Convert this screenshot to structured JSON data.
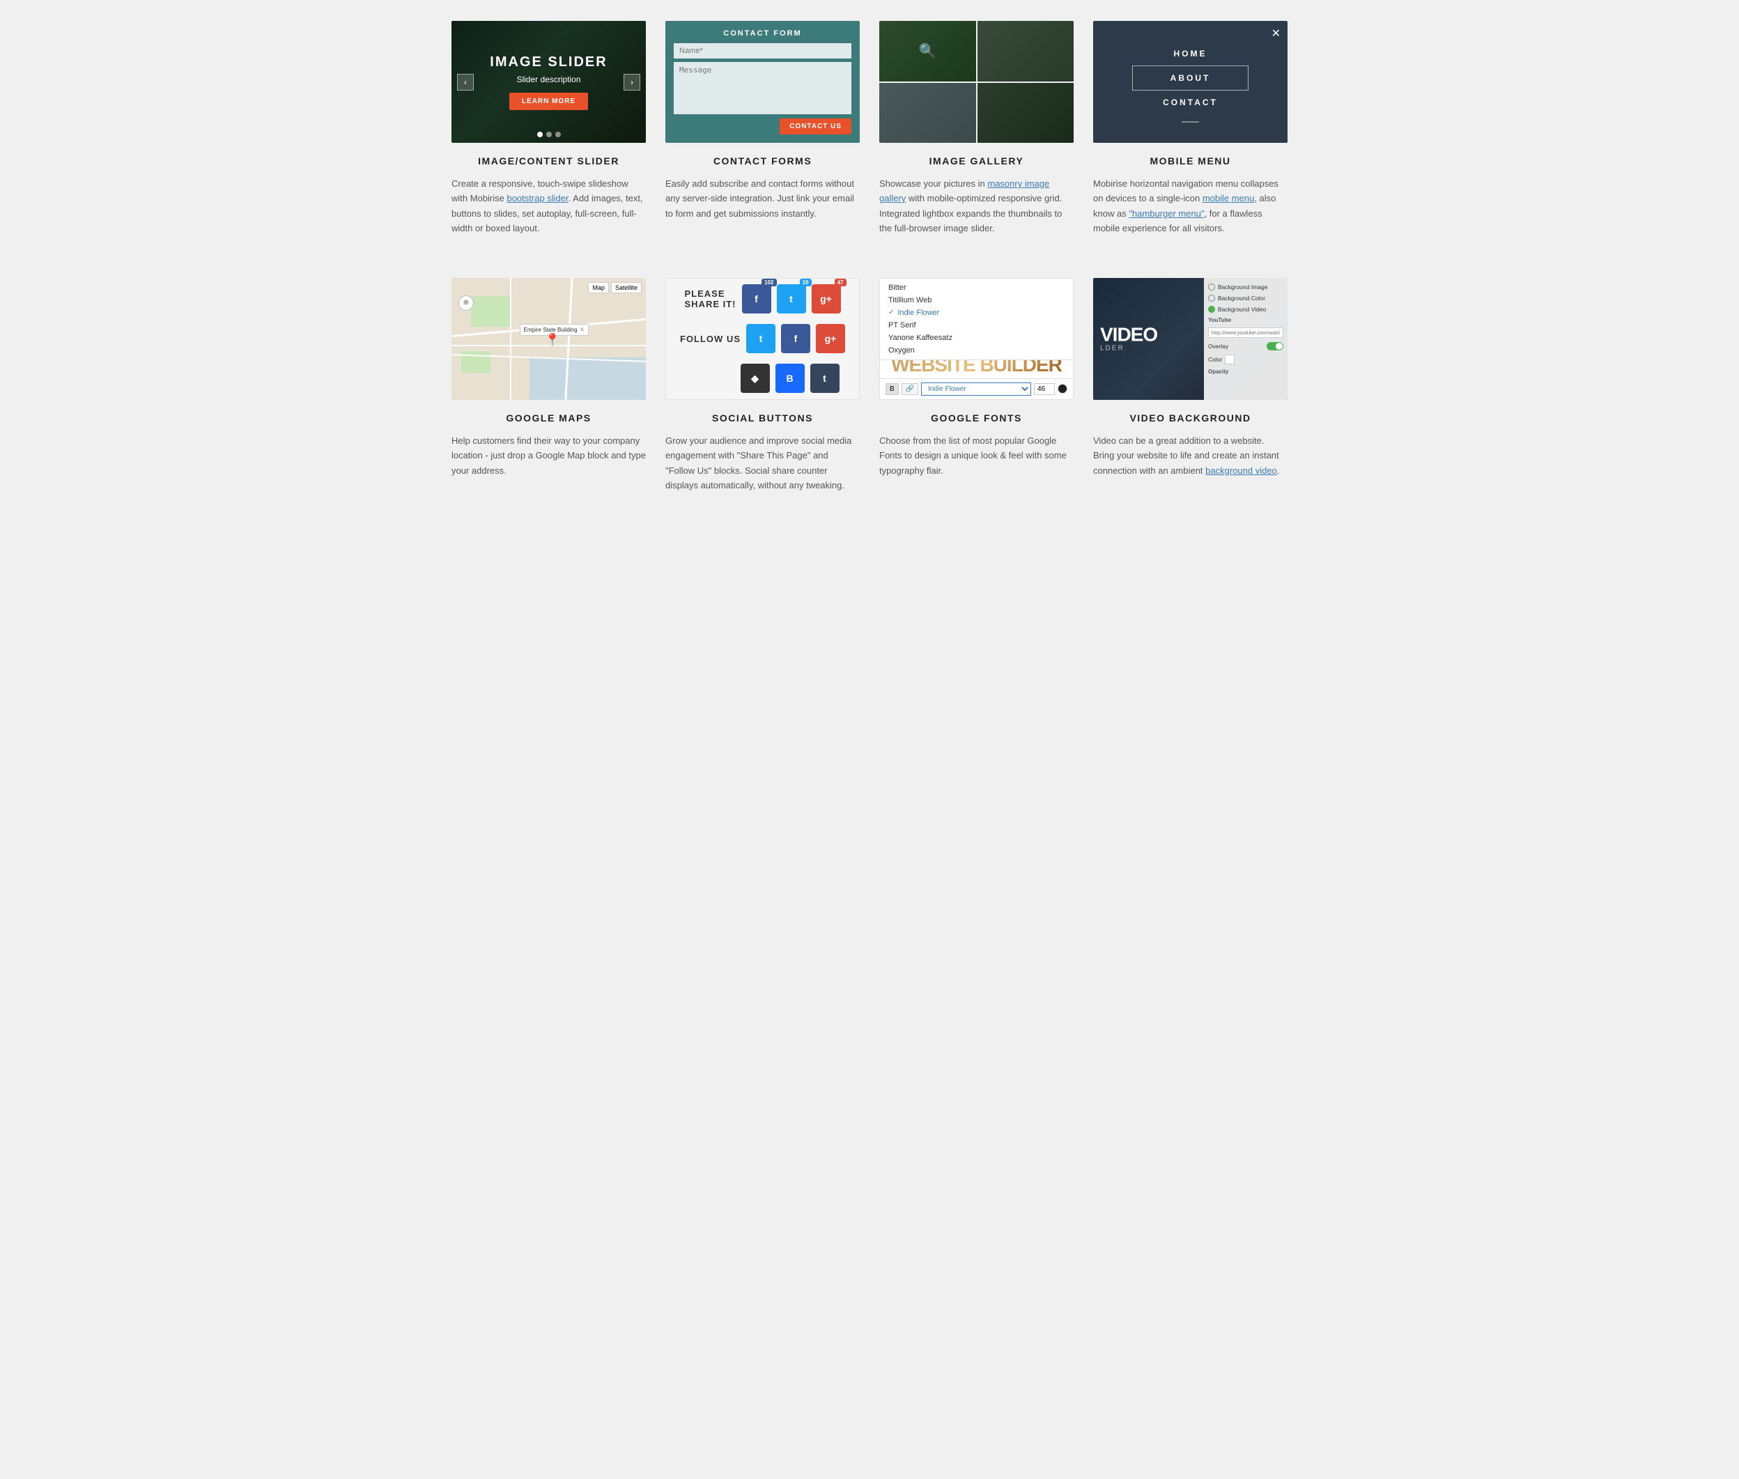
{
  "page": {
    "background": "#f0f0f0"
  },
  "row1": {
    "cards": [
      {
        "id": "image-slider",
        "title": "IMAGE/CONTENT SLIDER",
        "preview_title": "IMAGE SLIDER",
        "preview_desc": "Slider description",
        "btn_label": "LEARN MORE",
        "desc": "Create a responsive, touch-swipe slideshow with Mobirise ",
        "link1_text": "bootstrap slider",
        "link1_href": "#",
        "desc2": ". Add images, text, buttons to slides, set autoplay, full-screen, full-width or boxed layout.",
        "dots": 3,
        "arrows": [
          "‹",
          "›"
        ]
      },
      {
        "id": "contact-forms",
        "title": "CONTACT FORMS",
        "form_title": "CONTACT FORM",
        "name_placeholder": "Name*",
        "message_placeholder": "Message",
        "submit_label": "CONTACT US",
        "desc": "Easily add subscribe and contact forms without any server-side integration. Just link your email to form and get submissions instantly."
      },
      {
        "id": "image-gallery",
        "title": "IMAGE GALLERY",
        "desc": "Showcase your pictures in ",
        "link1_text": "masonry image gallery",
        "link1_href": "#",
        "desc2": " with mobile-optimized responsive grid. Integrated lightbox expands the thumbnails to the full-browser image slider."
      },
      {
        "id": "mobile-menu",
        "title": "MOBILE MENU",
        "menu_items": [
          "HOME",
          "ABOUT",
          "CONTACT"
        ],
        "active_item": "ABOUT",
        "desc": "Mobirise horizontal navigation menu collapses on devices to a single-icon ",
        "link1_text": "mobile menu",
        "link1_href": "#",
        "desc2": ", also know as ",
        "link2_text": "\"hamburger menu\"",
        "link2_href": "#",
        "desc3": ", for a flawless mobile experience for all visitors."
      }
    ]
  },
  "row2": {
    "cards": [
      {
        "id": "google-maps",
        "title": "GOOGLE MAPS",
        "map_label": "Empire State Building",
        "desc": "Help customers find their way to your company location - just drop a Google Map block and type your address."
      },
      {
        "id": "social-buttons",
        "title": "SOCIAL BUTTONS",
        "share_label": "PLEASE\nSHARE IT!",
        "follow_label": "FOLLOW US",
        "share_buttons": [
          {
            "type": "fb",
            "label": "f",
            "count": "102"
          },
          {
            "type": "tw",
            "label": "t",
            "count": "19"
          },
          {
            "type": "gp",
            "label": "g+",
            "count": "47"
          }
        ],
        "follow_buttons": [
          {
            "type": "tw",
            "label": "t"
          },
          {
            "type": "fb",
            "label": "f"
          },
          {
            "type": "gp",
            "label": "g+"
          }
        ],
        "extra_buttons": [
          {
            "type": "gh",
            "label": "◆"
          },
          {
            "type": "be",
            "label": "B"
          },
          {
            "type": "tm",
            "label": "t"
          }
        ],
        "desc": "Grow your audience and improve social media engagement with \"Share This Page\" and \"Follow Us\" blocks. Social share counter displays automatically, without any tweaking."
      },
      {
        "id": "google-fonts",
        "title": "GOOGLE FONTS",
        "font_list": [
          "Bitter",
          "Titillium Web",
          "Indie Flower",
          "PT Serif",
          "Yanone Kaffeesatz",
          "Oxygen"
        ],
        "selected_font": "Indie Flower",
        "font_size": "46",
        "preview_text": "WEBSITE BUILDER",
        "desc": "Choose from the list of most popular Google Fonts to design a unique look & feel with some typography flair."
      },
      {
        "id": "video-background",
        "title": "VIDEO BACKGROUND",
        "video_title": "VIDEO",
        "video_subtitle": "LDER",
        "panel": {
          "options": [
            {
              "label": "Background Image",
              "checked": false
            },
            {
              "label": "Background Color",
              "checked": false
            },
            {
              "label": "Background Video",
              "checked": true
            }
          ],
          "youtube_label": "YouTube",
          "youtube_placeholder": "http://www.youtube.com/watch?",
          "overlay_label": "Overlay",
          "color_label": "Color",
          "opacity_label": "Opacity"
        },
        "desc": "Video can be a great addition to a website. Bring your website to life and create an instant connection with an ambient ",
        "link1_text": "background video",
        "link1_href": "#",
        "desc2": "."
      }
    ]
  }
}
